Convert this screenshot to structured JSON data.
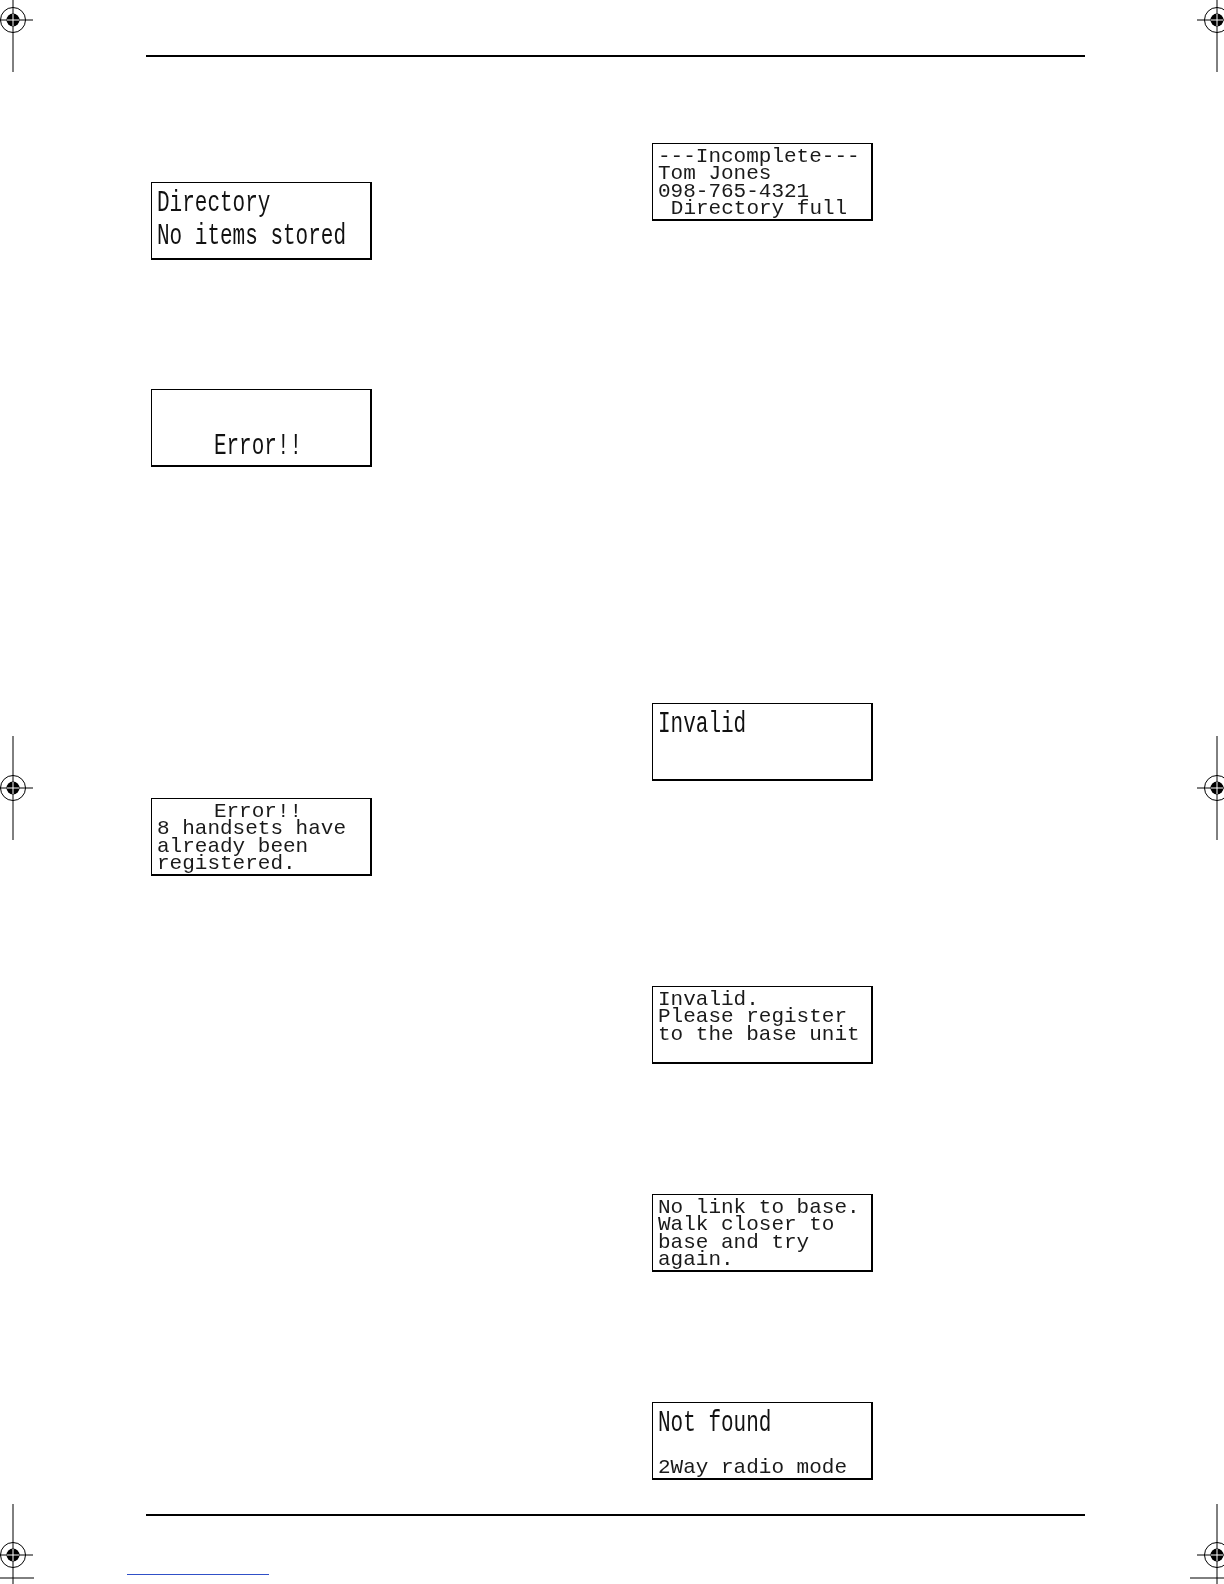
{
  "columns": [
    {
      "displays": [
        {
          "kind": "upper",
          "lines": [
            {
              "text": "Directory",
              "kind": "large",
              "centered": false
            },
            {
              "text": "No items stored",
              "kind": "large",
              "centered": false
            }
          ]
        },
        {
          "kind": "lower",
          "lines": [
            {
              "text": "Error!!",
              "kind": "large",
              "centered": true
            }
          ]
        },
        {
          "kind": "upper",
          "lines": [
            {
              "text": "Error!!",
              "kind": "small",
              "centered": true
            },
            {
              "text": "8 handsets have",
              "kind": "small",
              "centered": false
            },
            {
              "text": "already been",
              "kind": "small",
              "centered": false
            },
            {
              "text": "registered.",
              "kind": "small",
              "centered": false
            }
          ]
        }
      ]
    },
    {
      "displays": [
        {
          "kind": "upper",
          "lines": [
            {
              "text": "---Incomplete---",
              "kind": "small",
              "centered": false
            },
            {
              "text": "Tom Jones",
              "kind": "small",
              "centered": false
            },
            {
              "text": "098-765-4321",
              "kind": "small",
              "centered": false
            },
            {
              "text": "Directory full",
              "kind": "small",
              "centered": true
            }
          ]
        },
        {
          "kind": "upper",
          "lines": [
            {
              "text": "Invalid",
              "kind": "large",
              "centered": false
            }
          ]
        },
        {
          "kind": "upper",
          "lines": [
            {
              "text": "Invalid.",
              "kind": "small",
              "centered": false
            },
            {
              "text": "Please register",
              "kind": "small",
              "centered": false
            },
            {
              "text": "to the base unit",
              "kind": "small",
              "centered": false
            }
          ]
        },
        {
          "kind": "upper",
          "lines": [
            {
              "text": "No link to base.",
              "kind": "small",
              "centered": false
            },
            {
              "text": "Walk closer to",
              "kind": "small",
              "centered": false
            },
            {
              "text": "base and try",
              "kind": "small",
              "centered": false
            },
            {
              "text": "again.",
              "kind": "small",
              "centered": false
            }
          ]
        },
        {
          "kind": "split",
          "lines": [
            {
              "text": "Not found",
              "kind": "large",
              "centered": false
            },
            {
              "text": "2Way radio mode",
              "kind": "small",
              "centered": false
            }
          ]
        }
      ]
    }
  ]
}
